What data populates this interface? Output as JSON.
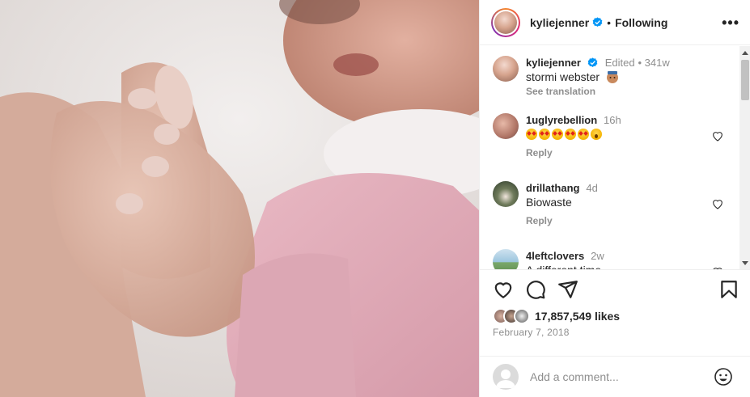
{
  "post": {
    "username": "kyliejenner",
    "follow_status": "Following",
    "more_icon": "more-options-icon"
  },
  "caption": {
    "username": "kyliejenner",
    "edited": "Edited",
    "age": "341w",
    "text": "stormi webster",
    "see_translation": "See translation"
  },
  "comments": [
    {
      "username": "1uglyrebellion",
      "age": "16h",
      "text": "",
      "emoji": [
        "star-struck",
        "star-struck",
        "star-struck",
        "star-struck",
        "star-struck",
        "astonished"
      ],
      "reply": "Reply"
    },
    {
      "username": "drillathang",
      "age": "4d",
      "text": "Biowaste",
      "reply": "Reply"
    },
    {
      "username": "4leftclovers",
      "age": "2w",
      "text": "A different time"
    }
  ],
  "stats": {
    "likes": "17,857,549 likes",
    "date": "February 7, 2018"
  },
  "add_comment": {
    "placeholder": "Add a comment..."
  },
  "colors": {
    "verified": "#0095f6",
    "text": "#262626",
    "muted": "#8e8e8e"
  }
}
